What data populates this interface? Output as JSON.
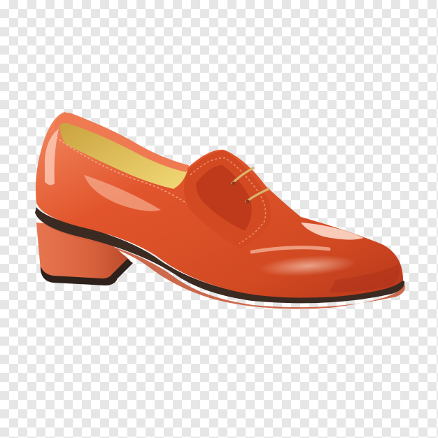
{
  "image": {
    "subject": "shoe",
    "background": "transparency-checkerboard",
    "colors": {
      "checker_light": "#ffffff",
      "checker_dark": "#e6e6e6",
      "patent_leather": "#e2552c",
      "leather_highlight": "#f7b79c",
      "leather_shadow": "#a8301a",
      "lining": "#e9c862",
      "sole_edge": "#3a2a22",
      "heel": "#d8613c",
      "laces": "#d9b46a"
    }
  }
}
